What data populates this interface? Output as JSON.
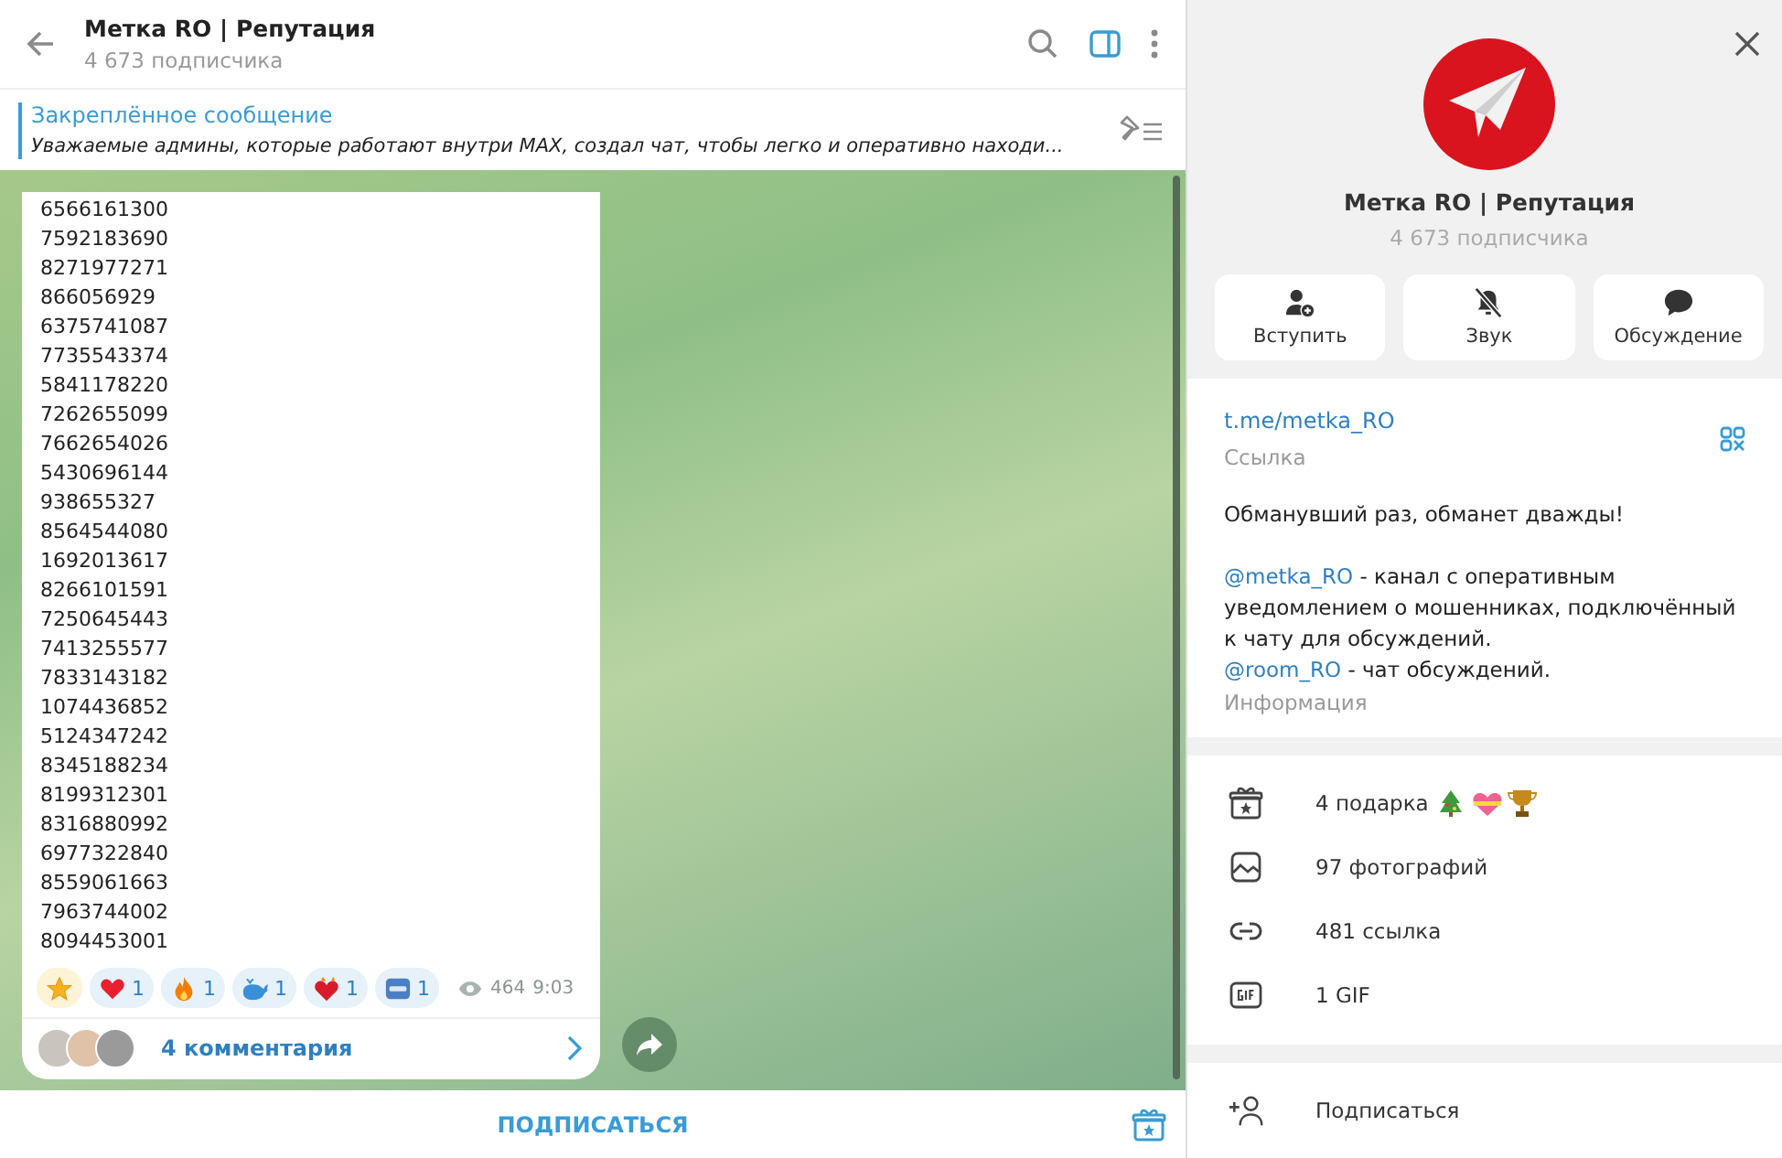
{
  "header": {
    "title": "Метка RO | Репутация",
    "subtitle": "4 673 подписчика",
    "side_panel_open": true
  },
  "pinned": {
    "title": "Закреплённое сообщение",
    "text": "Уважаемые админы, которые работают внутри MAX, создал чат, чтобы легко и оперативно находи..."
  },
  "message": {
    "lines": [
      "6566161300",
      "7592183690",
      "8271977271",
      "866056929",
      "6375741087",
      "7735543374",
      "5841178220",
      "7262655099",
      "7662654026",
      "5430696144",
      "938655327",
      "8564544080",
      "1692013617",
      "8266101591",
      "7250645443",
      "7413255577",
      "7833143182",
      "1074436852",
      "5124347242",
      "8345188234",
      "8199312301",
      "8316880992",
      "6977322840",
      "8559061663",
      "7963744002",
      "8094453001"
    ],
    "reactions": [
      {
        "kind": "star"
      },
      {
        "kind": "heart",
        "count": "1"
      },
      {
        "kind": "fire",
        "count": "1"
      },
      {
        "kind": "whale",
        "count": "1"
      },
      {
        "kind": "heart-fire",
        "count": "1"
      },
      {
        "kind": "cool",
        "count": "1"
      }
    ],
    "views": "464",
    "time": "9:03",
    "comments": "4 комментария"
  },
  "bottom_bar": {
    "subscribe": "ПОДПИСАТЬСЯ"
  },
  "profile": {
    "name": "Метка RO | Репутация",
    "subtitle": "4 673 подписчика",
    "actions": [
      {
        "kind": "join",
        "label": "Вступить"
      },
      {
        "kind": "mute",
        "label": "Звук"
      },
      {
        "kind": "discuss",
        "label": "Обсуждение"
      }
    ],
    "link": "t.me/metka_RO",
    "link_label": "Ссылка",
    "motto": "Обманувший раз, обманет дважды!",
    "description": [
      {
        "mention": "@metka_RO",
        "text": " - канал с оперативным уведомлением о мошенниках, подключённый к чату для обсуждений."
      },
      {
        "mention": "@room_RO",
        "text": " - чат обсуждений."
      }
    ],
    "info_label": "Информация",
    "media": [
      {
        "kind": "gifts",
        "label": "4 подарка"
      },
      {
        "kind": "photos",
        "label": "97 фотографий"
      },
      {
        "kind": "links",
        "label": "481 ссылка"
      },
      {
        "kind": "gif",
        "label": "1 GIF"
      }
    ],
    "subscribe": "Подписаться"
  }
}
